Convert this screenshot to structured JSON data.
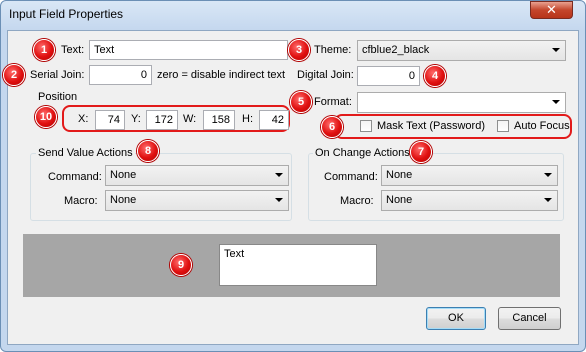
{
  "window": {
    "title": "Input Field Properties",
    "close_glyph": "✕"
  },
  "text_field": {
    "label": "Text:",
    "value": "Text"
  },
  "serial_join": {
    "label": "Serial Join:",
    "value": "0",
    "hint": "zero = disable indirect text"
  },
  "position": {
    "title": "Position",
    "x_label": "X:",
    "x": "74",
    "y_label": "Y:",
    "y": "172",
    "w_label": "W:",
    "w": "158",
    "h_label": "H:",
    "h": "42"
  },
  "theme": {
    "label": "Theme:",
    "value": "cfblue2_black"
  },
  "digital_join": {
    "label": "Digital Join:",
    "value": "0"
  },
  "format": {
    "label": "Format:",
    "value": ""
  },
  "mask_text": {
    "label": "Mask Text (Password)",
    "checked": false
  },
  "auto_focus": {
    "label": "Auto Focus",
    "checked": false
  },
  "send_value": {
    "title": "Send Value Actions",
    "command_label": "Command:",
    "command_value": "None",
    "macro_label": "Macro:",
    "macro_value": "None"
  },
  "on_change": {
    "title": "On Change Actions",
    "command_label": "Command:",
    "command_value": "None",
    "macro_label": "Macro:",
    "macro_value": "None"
  },
  "preview": {
    "text": "Text"
  },
  "buttons": {
    "ok": "OK",
    "cancel": "Cancel"
  },
  "badges": [
    "1",
    "2",
    "3",
    "4",
    "5",
    "6",
    "7",
    "8",
    "9",
    "10"
  ],
  "colors": {
    "badge_red": "#e01010",
    "title_bar": "#c4d7ee",
    "preview_bg": "#a6a6a6"
  }
}
